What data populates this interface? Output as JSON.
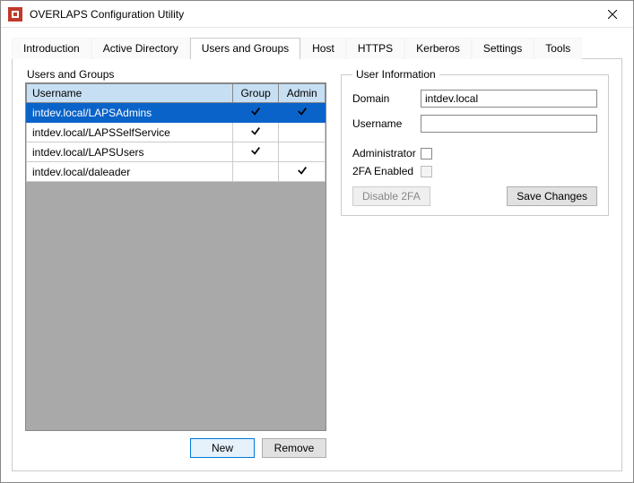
{
  "window": {
    "title": "OVERLAPS Configuration Utility",
    "icon_name": "overlaps-app-icon"
  },
  "tabs": [
    {
      "label": "Introduction",
      "active": false
    },
    {
      "label": "Active Directory",
      "active": false
    },
    {
      "label": "Users and Groups",
      "active": true
    },
    {
      "label": "Host",
      "active": false
    },
    {
      "label": "HTTPS",
      "active": false
    },
    {
      "label": "Kerberos",
      "active": false
    },
    {
      "label": "Settings",
      "active": false
    },
    {
      "label": "Tools",
      "active": false
    }
  ],
  "left_panel": {
    "title": "Users and Groups",
    "columns": {
      "username": "Username",
      "group": "Group",
      "admin": "Admin"
    },
    "rows": [
      {
        "username": "intdev.local/LAPSAdmins",
        "group": true,
        "admin": true,
        "selected": true
      },
      {
        "username": "intdev.local/LAPSSelfService",
        "group": true,
        "admin": false,
        "selected": false
      },
      {
        "username": "intdev.local/LAPSUsers",
        "group": true,
        "admin": false,
        "selected": false
      },
      {
        "username": "intdev.local/daleader",
        "group": false,
        "admin": true,
        "selected": false
      }
    ],
    "buttons": {
      "new": "New",
      "remove": "Remove"
    }
  },
  "right_panel": {
    "title": "User Information",
    "domain_label": "Domain",
    "domain_value": "intdev.local",
    "username_label": "Username",
    "username_value": "",
    "admin_label": "Administrator",
    "admin_checked": false,
    "twofa_label": "2FA Enabled",
    "twofa_checked": false,
    "twofa_chk_disabled": true,
    "disable2fa_label": "Disable 2FA",
    "disable2fa_disabled": true,
    "save_label": "Save Changes"
  }
}
